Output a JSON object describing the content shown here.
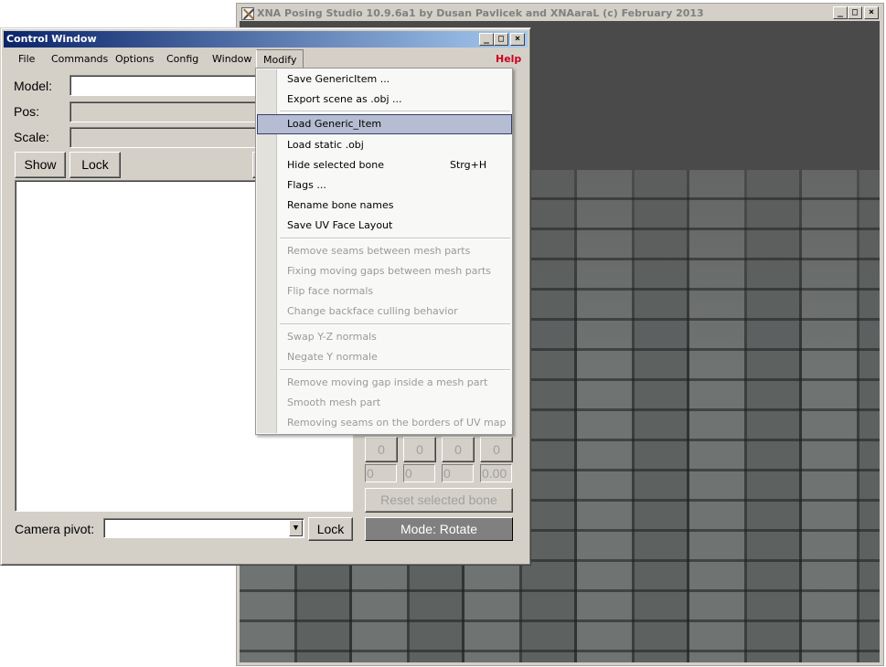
{
  "main_window": {
    "title": "XNA Posing Studio 10.9.6a1 by Dusan Pavlicek and XNAaraL (c) February 2013"
  },
  "control_window": {
    "title": "Control Window",
    "menu": [
      "File",
      "Commands",
      "Options",
      "Config",
      "Window",
      "Modify"
    ],
    "help": "Help",
    "model_label": "Model:",
    "pos_label": "Pos:",
    "scale_label": "Scale:",
    "model_value": "",
    "pos_value": "",
    "scale_value": "",
    "show": "Show",
    "lock": "Lock",
    "camera_pivot_label": "Camera pivot:",
    "camera_pivot_value": "",
    "camera_lock": "Lock",
    "zero_buttons": [
      "0",
      "0",
      "0",
      "0"
    ],
    "fields": [
      "0",
      "0",
      "0",
      "0.00"
    ],
    "reset": "Reset selected bone",
    "mode": "Mode: Rotate"
  },
  "modify_menu": {
    "items": [
      {
        "label": "Save GenericItem ...",
        "enabled": true
      },
      {
        "label": "Export scene as .obj ...",
        "enabled": true
      },
      {
        "label": "Load Generic_Item",
        "enabled": true,
        "highlighted": true
      },
      {
        "label": "Load static .obj",
        "enabled": true
      },
      {
        "label": "Hide selected bone",
        "enabled": true,
        "shortcut": "Strg+H"
      },
      {
        "label": "Flags ...",
        "enabled": true
      },
      {
        "label": "Rename bone names",
        "enabled": true
      },
      {
        "label": "Save UV Face Layout",
        "enabled": true
      },
      {
        "label": "Remove seams between mesh parts",
        "enabled": false
      },
      {
        "label": "Fixing moving gaps between mesh parts",
        "enabled": false
      },
      {
        "label": "Flip face normals",
        "enabled": false
      },
      {
        "label": "Change backface culling behavior",
        "enabled": false
      },
      {
        "label": "Swap Y-Z normals",
        "enabled": false
      },
      {
        "label": "Negate Y normale",
        "enabled": false
      },
      {
        "label": "Remove moving gap inside a mesh part",
        "enabled": false
      },
      {
        "label": "Smooth mesh part",
        "enabled": false
      },
      {
        "label": "Removing seams on the borders of UV map",
        "enabled": false
      }
    ]
  },
  "colors": {
    "title_active_start": "#0a246a",
    "title_active_end": "#a6caf0",
    "help": "#cc0022",
    "highlight": "#b6bdd2",
    "mode_button": "#808080"
  }
}
